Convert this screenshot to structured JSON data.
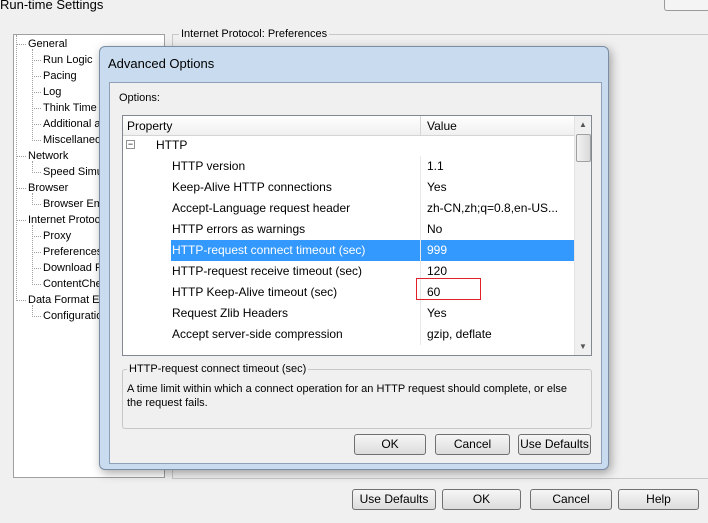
{
  "window": {
    "title": "Run-time Settings",
    "group_label": "Internet Protocol: Preferences",
    "buttons": {
      "use_defaults": "Use Defaults",
      "ok": "OK",
      "cancel": "Cancel",
      "help": "Help"
    }
  },
  "tree": {
    "items": [
      {
        "label": "General",
        "level": 0
      },
      {
        "label": "Run Logic",
        "level": 1
      },
      {
        "label": "Pacing",
        "level": 1
      },
      {
        "label": "Log",
        "level": 1
      },
      {
        "label": "Think Time",
        "level": 1
      },
      {
        "label": "Additional a",
        "level": 1
      },
      {
        "label": "Miscellaneo",
        "level": 1
      },
      {
        "label": "Network",
        "level": 0
      },
      {
        "label": "Speed Simu",
        "level": 1
      },
      {
        "label": "Browser",
        "level": 0
      },
      {
        "label": "Browser Em",
        "level": 1
      },
      {
        "label": "Internet Protoc",
        "level": 0
      },
      {
        "label": "Proxy",
        "level": 1
      },
      {
        "label": "Preferences",
        "level": 1
      },
      {
        "label": "Download F",
        "level": 1
      },
      {
        "label": "ContentChe",
        "level": 1
      },
      {
        "label": "Data Format Ex",
        "level": 0
      },
      {
        "label": "Configuratio",
        "level": 1
      }
    ]
  },
  "dialog": {
    "title": "Advanced Options",
    "options_label": "Options:",
    "grid": {
      "col_property": "Property",
      "col_value": "Value",
      "group": {
        "expander": "−",
        "label": "HTTP"
      },
      "rows": [
        {
          "property": "HTTP version",
          "value": "1.1"
        },
        {
          "property": "Keep-Alive HTTP connections",
          "value": "Yes"
        },
        {
          "property": "Accept-Language request header",
          "value": "zh-CN,zh;q=0.8,en-US..."
        },
        {
          "property": "HTTP errors as warnings",
          "value": "No"
        },
        {
          "property": "HTTP-request connect timeout (sec)",
          "value": "999"
        },
        {
          "property": "HTTP-request receive timeout (sec)",
          "value": "120"
        },
        {
          "property": "HTTP Keep-Alive timeout (sec)",
          "value": "60"
        },
        {
          "property": "Request Zlib Headers",
          "value": "Yes"
        },
        {
          "property": "Accept server-side compression",
          "value": "gzip, deflate"
        }
      ],
      "selected_index": 4
    },
    "description": {
      "title": "HTTP-request connect timeout (sec)",
      "text": "A time limit within which a connect operation for an HTTP request should complete, or else the request fails."
    },
    "buttons": {
      "ok": "OK",
      "cancel": "Cancel",
      "use_defaults": "Use Defaults"
    }
  },
  "colors": {
    "selection": "#3399ff",
    "highlight_box": "#e2202a",
    "dialog_frame": "#c9dbee"
  }
}
